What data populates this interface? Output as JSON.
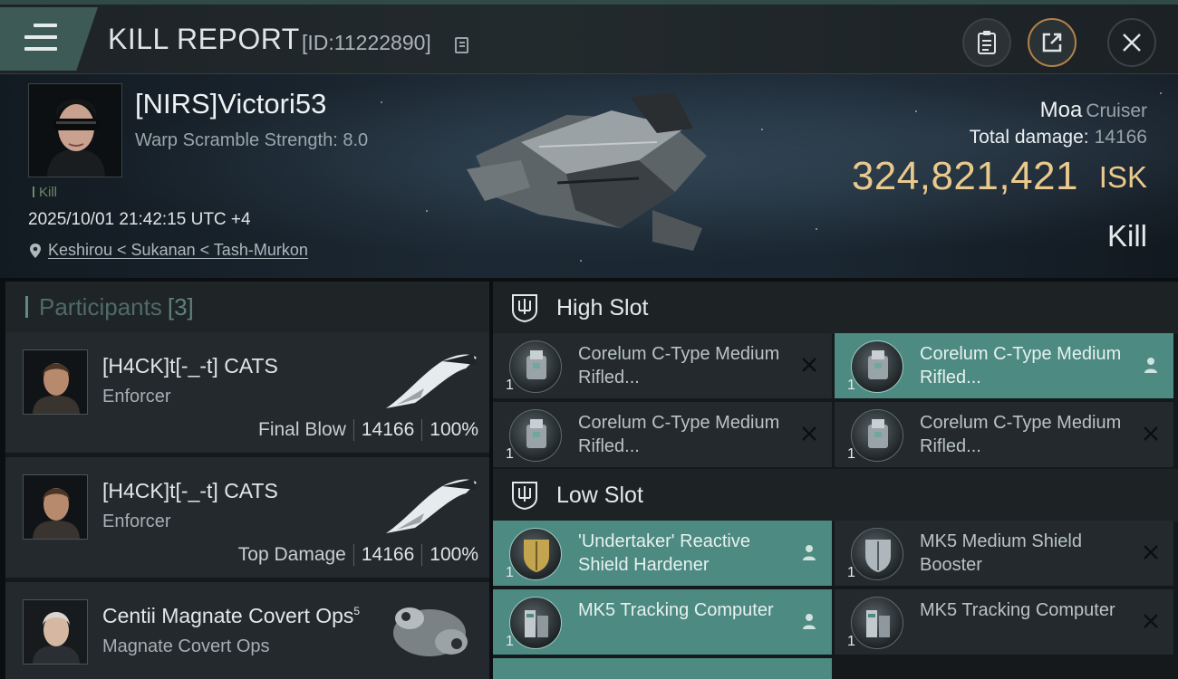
{
  "header": {
    "title": "KILL REPORT",
    "kill_id": "[ID:11222890]",
    "icons": [
      "menu-icon",
      "copy-icon",
      "clipboard-icon",
      "share-icon",
      "close-icon"
    ]
  },
  "victim": {
    "name": "[NIRS]Victori53",
    "warp_scramble": "Warp Scramble Strength: 8.0",
    "tag": "Kill",
    "timestamp": "2025/10/01 21:42:15 UTC +4",
    "location": "Keshirou < Sukanan < Tash-Murkon",
    "ship": "Moa",
    "ship_class": "Cruiser",
    "damage_label": "Total damage:",
    "damage_value": "14166",
    "isk_value": "324,821,421",
    "isk_unit": "ISK",
    "result": "Kill"
  },
  "participants": {
    "label": "Participants",
    "count": "[3]",
    "items": [
      {
        "name": "[H4CK]t[-_-t] CATS",
        "ship": "Enforcer",
        "role": "Final Blow",
        "damage": "14166",
        "percent": "100%"
      },
      {
        "name": "[H4CK]t[-_-t] CATS",
        "ship": "Enforcer",
        "role": "Top Damage",
        "damage": "14166",
        "percent": "100%"
      },
      {
        "name": "Centii Magnate Covert Ops",
        "name_sup": "5",
        "ship": "Magnate Covert Ops",
        "role": "",
        "damage": "",
        "percent": ""
      }
    ]
  },
  "fitting": {
    "high_slot": {
      "label": "High Slot",
      "modules": [
        {
          "name": "Corelum C-Type Medium Rifled...",
          "qty": "1",
          "state": "destroyed",
          "status_icon": "close-icon"
        },
        {
          "name": "Corelum C-Type Medium Rifled...",
          "qty": "1",
          "state": "dropped",
          "status_icon": "person-icon"
        },
        {
          "name": "Corelum C-Type Medium Rifled...",
          "qty": "1",
          "state": "destroyed",
          "status_icon": "close-icon"
        },
        {
          "name": "Corelum C-Type Medium Rifled...",
          "qty": "1",
          "state": "destroyed",
          "status_icon": "close-icon"
        }
      ]
    },
    "low_slot": {
      "label": "Low Slot",
      "modules": [
        {
          "name": "'Undertaker' Reactive Shield Hardener",
          "qty": "1",
          "state": "dropped",
          "status_icon": "person-icon"
        },
        {
          "name": "MK5 Medium Shield Booster",
          "qty": "1",
          "state": "destroyed",
          "status_icon": "close-icon"
        },
        {
          "name": "MK5 Tracking Computer",
          "qty": "1",
          "state": "dropped",
          "status_icon": "person-icon"
        },
        {
          "name": "MK5 Tracking Computer",
          "qty": "1",
          "state": "destroyed",
          "status_icon": "close-icon"
        }
      ]
    }
  },
  "colors": {
    "accent_teal": "#4c8a82",
    "isk_gold": "#eac98d",
    "panel": "#23292c"
  }
}
